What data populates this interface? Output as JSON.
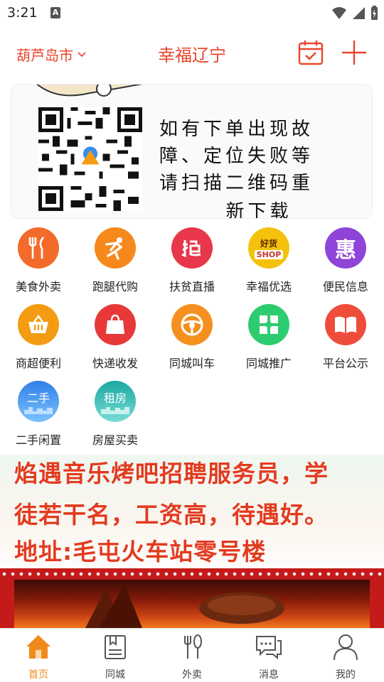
{
  "status_bar": {
    "time": "3:21",
    "notification_icon": "A"
  },
  "header": {
    "city": "葫芦岛市",
    "title": "幸福辽宁",
    "calendar_icon": "calendar-icon",
    "plus_icon": "plus-icon"
  },
  "top_banner": {
    "notice_lines": [
      "如有下单出现故",
      "障、定位失败等",
      "请扫描二维码重"
    ],
    "notice_last": "新下载"
  },
  "services": [
    {
      "label": "美食外卖",
      "icon": "fork-knife-icon",
      "color": "#f36b2b"
    },
    {
      "label": "跑腿代购",
      "icon": "runner-icon",
      "color": "#f5891c"
    },
    {
      "label": "扶贫直播",
      "icon": "grab-icon",
      "color": "#e8364a"
    },
    {
      "label": "幸福优选",
      "icon": "good-shop-icon",
      "color": "#f4c20d"
    },
    {
      "label": "便民信息",
      "icon": "hui-icon",
      "color": "#8e44d8"
    },
    {
      "label": "商超便利",
      "icon": "basket-icon",
      "color": "#f39c12"
    },
    {
      "label": "快递收发",
      "icon": "bag-icon",
      "color": "#e8393a"
    },
    {
      "label": "同城叫车",
      "icon": "steering-wheel-icon",
      "color": "#f5901e"
    },
    {
      "label": "同城推广",
      "icon": "clover-icon",
      "color": "#2ecc71"
    },
    {
      "label": "平台公示",
      "icon": "book-icon",
      "color": "#ef4d3b"
    },
    {
      "label": "二手闲置",
      "icon": "secondhand-icon",
      "color": "#3b8fe8"
    },
    {
      "label": "房屋买卖",
      "icon": "rent-house-icon",
      "color": "#27b7b0"
    }
  ],
  "service_icon_text": {
    "hui": "惠",
    "good_shop_top": "好货",
    "good_shop_bottom": "SHOP",
    "secondhand": "二手",
    "rent": "租房"
  },
  "bottom_banner": {
    "lines": [
      "焰遇音乐烤吧招聘服务员，学",
      "徒若干名，工资高，待遇好。",
      "地址:毛屯火车站零号楼"
    ]
  },
  "tabbar": [
    {
      "label": "首页",
      "icon": "home-icon",
      "active": true
    },
    {
      "label": "同城",
      "icon": "bookmark-book-icon",
      "active": false
    },
    {
      "label": "外卖",
      "icon": "fork-spoon-icon",
      "active": false
    },
    {
      "label": "消息",
      "icon": "chat-bubble-icon",
      "active": false
    },
    {
      "label": "我的",
      "icon": "user-icon",
      "active": false
    }
  ],
  "colors": {
    "accent": "#e8452c",
    "tab_active": "#f08a1c"
  }
}
